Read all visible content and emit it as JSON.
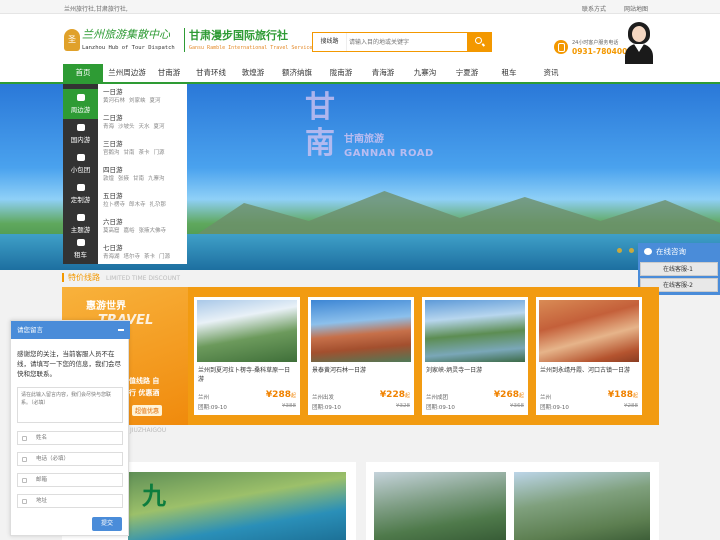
{
  "topbar": {
    "left_text": "兰州旅行社,甘肃旅行社,",
    "contact": "联系方式",
    "sitemap": "网站地图"
  },
  "header": {
    "seal": "圣",
    "logo_cn": "兰州旅游集散中心",
    "logo_en": "Lanzhou Hub of Tour Dispatch",
    "brand_cn": "甘肃漫步国际旅行社",
    "brand_en": "Gansu Ramble International Travel Service",
    "search_type": "搜线路",
    "search_placeholder": "请输入目的地或关键字",
    "hotline_label": "24小时客户服务电话",
    "hotline_number": "0931-7804003"
  },
  "nav": [
    "首页",
    "兰州周边游",
    "甘南游",
    "甘青环线",
    "敦煌游",
    "额济纳旗",
    "陇南游",
    "青海游",
    "九寨沟",
    "宁夏游",
    "租车",
    "资讯"
  ],
  "category": {
    "tabs": [
      "周边游",
      "国内游",
      "小包团",
      "定制游",
      "主题游",
      "租车"
    ],
    "groups": [
      {
        "title": "一日游",
        "subs": [
          "黄河石林",
          "刘家峡",
          "夏河"
        ]
      },
      {
        "title": "二日游",
        "subs": [
          "青海",
          "沙坡头",
          "天水",
          "夏河"
        ]
      },
      {
        "title": "三日游",
        "subs": [
          "官鹅沟",
          "甘南",
          "茶卡",
          "门源"
        ]
      },
      {
        "title": "四日游",
        "subs": [
          "敦煌",
          "张掖",
          "甘南",
          "九寨沟"
        ]
      },
      {
        "title": "五日游",
        "subs": [
          "拉卜楞寺",
          "郎木寺",
          "扎尕那"
        ]
      },
      {
        "title": "六日游",
        "subs": [
          "莫高窟",
          "嘉峪",
          "张掖大佛寺"
        ]
      },
      {
        "title": "七日游",
        "subs": [
          "青海湖",
          "塔尔寺",
          "茶卡",
          "门源"
        ]
      }
    ]
  },
  "banner": {
    "title": "甘南",
    "sub1": "甘南旅游",
    "sub2": "GANNAN ROAD"
  },
  "service": {
    "title": "在线咨询",
    "agents": [
      "在线客服-1",
      "在线客服-2"
    ]
  },
  "special": {
    "title": "特价线路",
    "title_en": "LIMITED TIME DISCOUNT",
    "promo": {
      "t1": "惠游世界",
      "t2": "TRAVEL",
      "t3": "超值线路 自由行 优惠酒店",
      "badge": "超值优惠"
    },
    "cards": [
      {
        "name": "兰州到夏河拉卜楞寺-桑科草原一日游",
        "from": "兰州",
        "date": "团期:09-10",
        "price": "¥288",
        "unit": "起",
        "old": "¥388"
      },
      {
        "name": "景泰黄河石林一日游",
        "from": "兰州出发",
        "date": "团期:09-10",
        "price": "¥228",
        "unit": "起",
        "old": "¥328"
      },
      {
        "name": "刘家峡-炳灵寺一日游",
        "from": "兰州成团",
        "date": "团期:09-10",
        "price": "¥268",
        "unit": "起",
        "old": "¥368"
      },
      {
        "name": "兰州到永靖丹霞、河口古镇一日游",
        "from": "兰州",
        "date": "团期:09-10",
        "price": "¥188",
        "unit": "起",
        "old": "¥288"
      }
    ]
  },
  "lower": {
    "title_en": "JIUZHAIGOU",
    "jiu": "九"
  },
  "message": {
    "title": "请您留言",
    "intro": "感谢您的关注，当前客服人员不在线，请填写一下您的信息，我们会尽快和您联系。",
    "textarea_placeholder": "请在此输入留言内容，我们会尽快与您联系。（必填）",
    "fields": [
      "姓名",
      "电话（必填）",
      "邮箱",
      "地址"
    ],
    "submit": "提交"
  },
  "colors": {
    "green": "#2e9b34",
    "orange": "#f39800",
    "blue": "#4a8cd9"
  }
}
